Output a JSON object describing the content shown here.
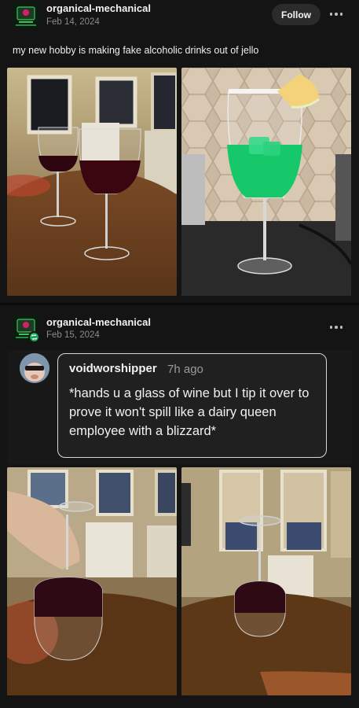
{
  "post1": {
    "blog_name": "organical-mechanical",
    "date": "Feb 14, 2024",
    "follow_label": "Follow",
    "caption": "my new hobby is making fake alcoholic drinks out of jello",
    "images": [
      {
        "icon": "photo-wine-glasses"
      },
      {
        "icon": "photo-green-jello-drink"
      }
    ]
  },
  "post2": {
    "blog_name": "organical-mechanical",
    "date": "Feb 15, 2024",
    "reblogged_tweet": {
      "username": "voidworshipper",
      "time": "7h ago",
      "text": "*hands u a glass of wine but I tip it over to prove it won't spill like a dairy queen employee with a blizzard*"
    },
    "images": [
      {
        "icon": "photo-hand-tipping-glass"
      },
      {
        "icon": "photo-upside-down-glass"
      }
    ]
  },
  "colors": {
    "background": "#141414",
    "accent_green": "#19a55a",
    "wine": "#3a0610",
    "jello_green": "#17c86a"
  }
}
